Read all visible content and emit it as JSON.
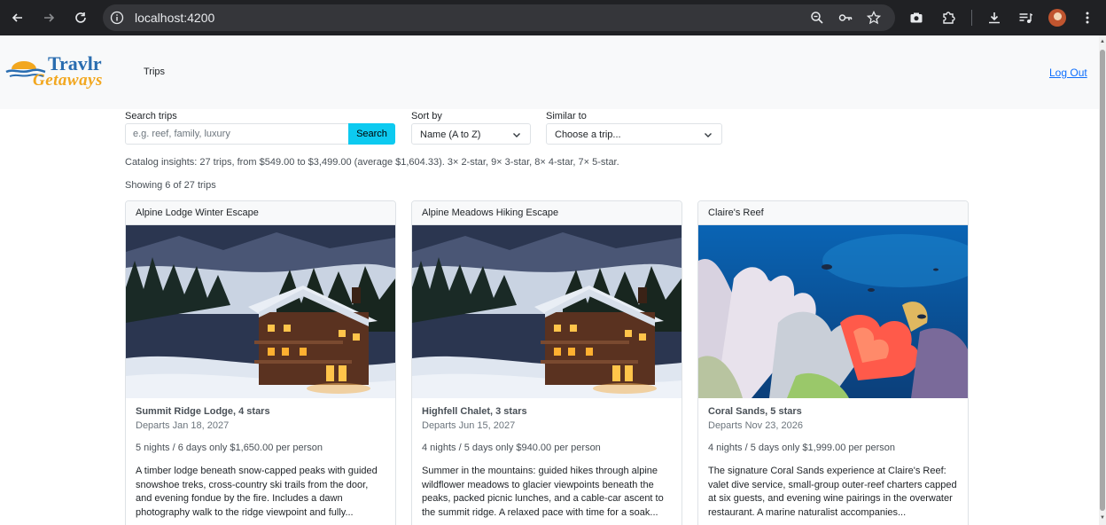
{
  "browser": {
    "url": "localhost:4200",
    "icons": [
      "back-icon",
      "forward-icon",
      "reload-icon",
      "info-icon",
      "zoom-icon",
      "key-icon",
      "star-icon",
      "camera-icon",
      "extensions-icon",
      "download-icon",
      "media-icon",
      "profile-avatar",
      "menu-icon"
    ]
  },
  "header": {
    "logo_top": "Travlr",
    "logo_bottom": "Getaways",
    "nav_trips": "Trips",
    "logout": "Log Out"
  },
  "filters": {
    "search_label": "Search trips",
    "search_placeholder": "e.g. reef, family, luxury",
    "search_button": "Search",
    "sort_label": "Sort by",
    "sort_value": "Name (A to Z)",
    "similar_label": "Similar to",
    "similar_value": "Choose a trip..."
  },
  "insights": "Catalog insights: 27 trips, from $549.00 to $3,499.00 (average $1,604.33). 3× 2-star, 9× 3-star, 8× 4-star, 7× 5-star.",
  "showing": "Showing 6 of 27 trips",
  "cards": [
    {
      "title": "Alpine Lodge Winter Escape",
      "lodge": "Summit Ridge Lodge, 4 stars",
      "departs": "Departs Jan 18, 2027",
      "price": "5 nights / 6 days only $1,650.00 per person",
      "description": "A timber lodge beneath snow-capped peaks with guided snowshoe treks, cross-country ski trails from the door, and evening fondue by the fire. Includes a dawn photography walk to the ridge viewpoint and fully..."
    },
    {
      "title": "Alpine Meadows Hiking Escape",
      "lodge": "Highfell Chalet, 3 stars",
      "departs": "Departs Jun 15, 2027",
      "price": "4 nights / 5 days only $940.00 per person",
      "description": "Summer in the mountains: guided hikes through alpine wildflower meadows to glacier viewpoints beneath the peaks, packed picnic lunches, and a cable-car ascent to the summit ridge. A relaxed pace with time for a soak..."
    },
    {
      "title": "Claire's Reef",
      "lodge": "Coral Sands, 5 stars",
      "departs": "Departs Nov 23, 2026",
      "price": "4 nights / 5 days only $1,999.00 per person",
      "description": "The signature Coral Sands experience at Claire's Reef: valet dive service, small-group outer-reef charters capped at six guests, and evening wine pairings in the overwater restaurant. A marine naturalist accompanies..."
    }
  ]
}
